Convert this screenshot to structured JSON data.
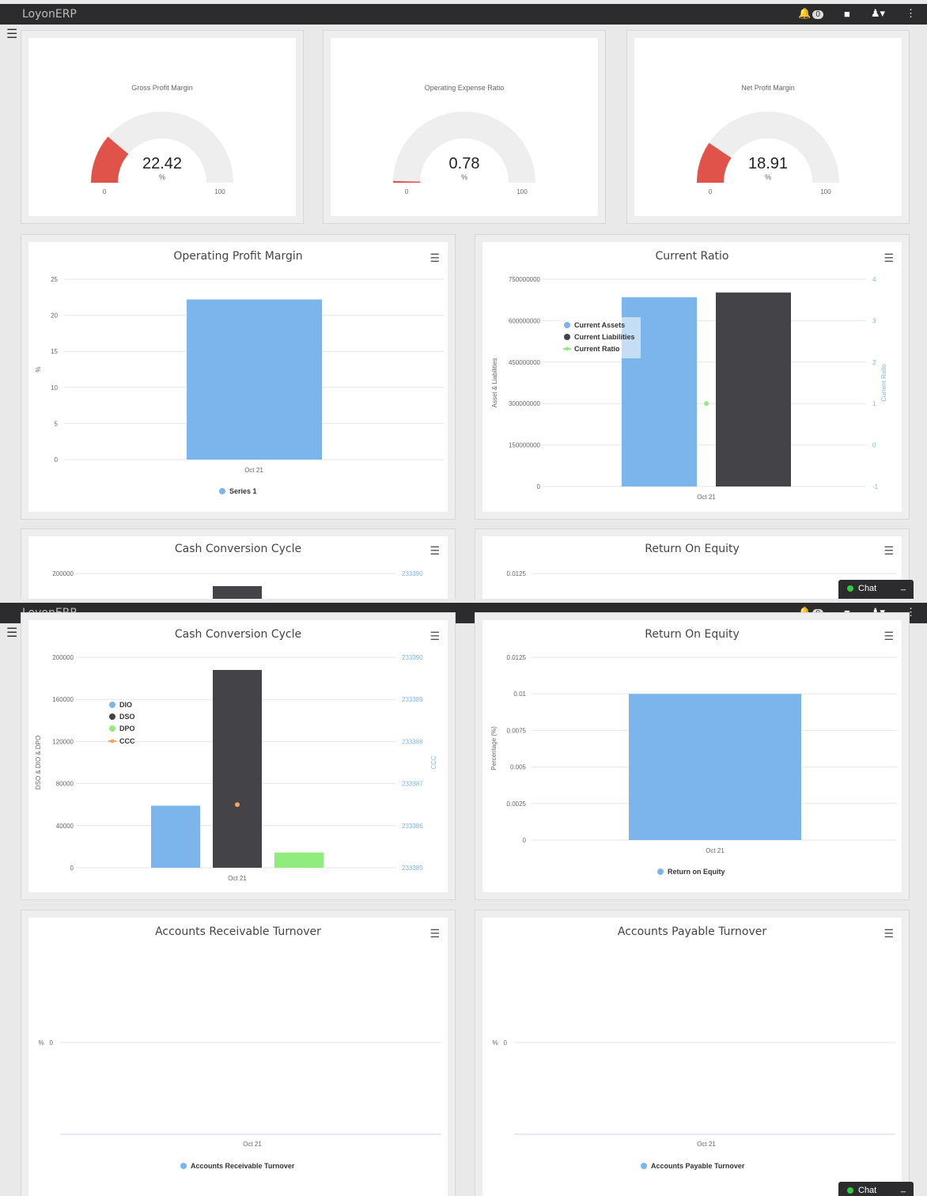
{
  "app": {
    "brand": "LoyonERP",
    "notif_count": "0",
    "chat_label": "Chat"
  },
  "gauges": [
    {
      "title": "Gross Profit Margin",
      "value": "22.42",
      "unit": "%",
      "min": "0",
      "max": "100",
      "fraction": 0.2242
    },
    {
      "title": "Operating Expense Ratio",
      "value": "0.78",
      "unit": "%",
      "min": "0",
      "max": "100",
      "fraction": 0.0078
    },
    {
      "title": "Net Profit Margin",
      "value": "18.91",
      "unit": "%",
      "min": "0",
      "max": "100",
      "fraction": 0.1891
    }
  ],
  "panels": {
    "opm": "Operating Profit Margin",
    "cr": "Current Ratio",
    "ccc": "Cash Conversion Cycle",
    "roe": "Return On Equity",
    "art": "Accounts Receivable Turnover",
    "apt": "Accounts Payable Turnover"
  },
  "colors": {
    "blue": "#7cb5ec",
    "dark": "#434348",
    "green": "#90ed7d",
    "orange": "#f7a35c",
    "red": "#e0534a"
  },
  "chart_data": [
    {
      "id": "opm",
      "type": "bar",
      "title": "Operating Profit Margin",
      "categories": [
        "Oct 21"
      ],
      "ylabel": "%",
      "ylim": [
        0,
        25
      ],
      "yticks": [
        "0",
        "5",
        "10",
        "15",
        "20",
        "25"
      ],
      "series": [
        {
          "name": "Series 1",
          "values": [
            22.2
          ]
        }
      ]
    },
    {
      "id": "cr",
      "type": "bar",
      "title": "Current Ratio",
      "categories": [
        "Oct 21"
      ],
      "ylabel": "Asset & Liabilities",
      "y2label": "Current Ratio",
      "ylim": [
        0,
        750000000
      ],
      "yticks": [
        "0",
        "150000000",
        "300000000",
        "450000000",
        "600000000",
        "750000000"
      ],
      "y2lim": [
        -1,
        4
      ],
      "y2ticks": [
        "-1",
        "0",
        "1",
        "2",
        "3",
        "4"
      ],
      "series": [
        {
          "name": "Current Assets",
          "values": [
            685000000
          ]
        },
        {
          "name": "Current Liabilities",
          "values": [
            702000000
          ]
        },
        {
          "name": "Current Ratio",
          "type": "line",
          "values": [
            1.0
          ]
        }
      ]
    },
    {
      "id": "ccc",
      "type": "bar",
      "title": "Cash Conversion Cycle",
      "categories": [
        "Oct 21"
      ],
      "ylabel": "DSO & DIO & DPO",
      "y2label": "CCC",
      "ylim": [
        0,
        200000
      ],
      "yticks": [
        "0",
        "40000",
        "80000",
        "120000",
        "160000",
        "200000"
      ],
      "y2ticks": [
        "233385",
        "233386",
        "233387",
        "233388",
        "233389",
        "233390"
      ],
      "series": [
        {
          "name": "DIO",
          "values": [
            59000
          ]
        },
        {
          "name": "DSO",
          "values": [
            188000
          ]
        },
        {
          "name": "DPO",
          "values": [
            14500
          ]
        },
        {
          "name": "CCC",
          "type": "line",
          "values": [
            233386.5
          ]
        }
      ]
    },
    {
      "id": "roe",
      "type": "bar",
      "title": "Return On Equity",
      "categories": [
        "Oct 21"
      ],
      "ylabel": "Percentage (%)",
      "ylim": [
        0,
        0.0125
      ],
      "yticks": [
        "0",
        "0.0025",
        "0.005",
        "0.0075",
        "0.01",
        "0.0125"
      ],
      "series": [
        {
          "name": "Return on Equity",
          "values": [
            0.01
          ]
        }
      ]
    },
    {
      "id": "art",
      "type": "line",
      "title": "Accounts Receivable Turnover",
      "categories": [
        "Oct 21"
      ],
      "ylabel": "%",
      "yticks": [
        "0"
      ],
      "series": [
        {
          "name": "Accounts Receivable Turnover",
          "values": []
        }
      ]
    },
    {
      "id": "apt",
      "type": "line",
      "title": "Accounts Payable Turnover",
      "categories": [
        "Oct 21"
      ],
      "ylabel": "%",
      "yticks": [
        "0"
      ],
      "series": [
        {
          "name": "Accounts Payable Turnover",
          "values": []
        }
      ]
    }
  ]
}
